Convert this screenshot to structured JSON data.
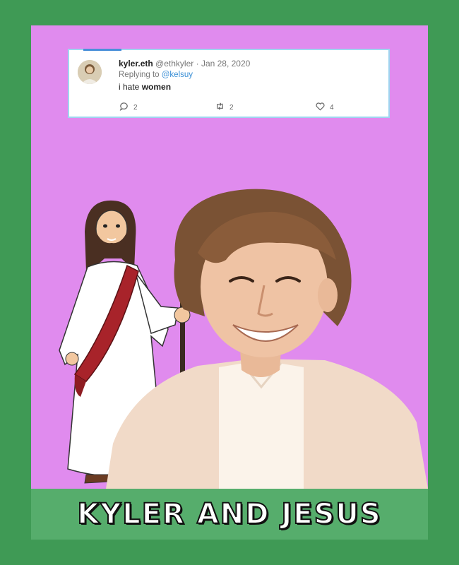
{
  "tweet": {
    "display_name": "kyler.eth",
    "handle": "@ethkyler",
    "separator": "·",
    "date": "Jan 28, 2020",
    "replying_prefix": "Replying to",
    "replying_to": "@kelsuy",
    "text_start": "i hate",
    "text_bold": "women",
    "reply_count": "2",
    "retweet_count": "2",
    "like_count": "4"
  },
  "caption": "KYLER AND JESUS",
  "colors": {
    "outer_border": "#3f9a55",
    "card_background": "#e08bee",
    "caption_bar": "#56ad6c",
    "link_blue": "#3a8fd6"
  },
  "icons": [
    "reply-icon",
    "retweet-icon",
    "like-icon"
  ]
}
